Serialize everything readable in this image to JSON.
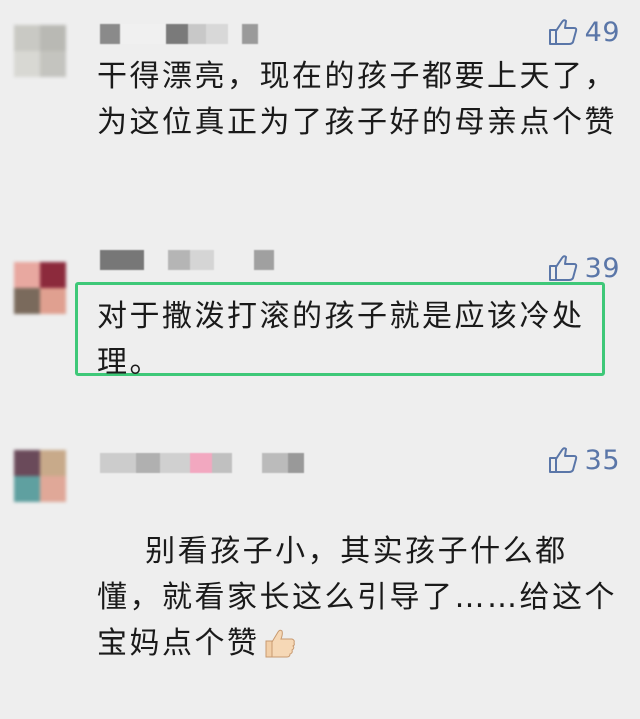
{
  "comments": [
    {
      "likes": "49",
      "text": "干得漂亮，现在的孩子都要上天了，为这位真正为了孩子好的母亲点个赞",
      "avatar_colors": [
        "#c9c9c4",
        "#b9b9b4",
        "#d8d8d3",
        "#c4c4bf"
      ],
      "name_colors": [
        "#8a8a8a",
        "#f0f0f0",
        "#7a7a7a",
        "#c8c8c8",
        "#d8d8d8",
        "#9a9a9a",
        "#aaaaaa"
      ]
    },
    {
      "likes": "39",
      "text": "对于撒泼打滚的孩子就是应该冷处理。",
      "avatar_colors": [
        "#e8a8a0",
        "#8c2a3c",
        "#7a6a5c",
        "#e0a090"
      ],
      "name_colors": [
        "#777777",
        "#eeeeee",
        "#b5b5b5",
        "#d5d5d5",
        "#eeeeee",
        "#a0a0a0"
      ]
    },
    {
      "likes": "35",
      "text": "别看孩子小，其实孩子什么都懂，就看家长这么引导了……给这个宝妈点个赞",
      "avatar_colors": [
        "#6a4a5a",
        "#c8aa8a",
        "#5fa0a0",
        "#e0a898"
      ],
      "name_colors": [
        "#cccccc",
        "#b0b0b0",
        "#d0d0d0",
        "#f2a8c0",
        "#c0c0c0",
        "#eeeeee",
        "#bbbbbb",
        "#999999"
      ]
    }
  ],
  "icons": {
    "like": "thumbs-up-icon",
    "emoji": "thumbs-up-emoji"
  },
  "colors": {
    "background": "#eeeeee",
    "highlight_border": "#3ec878",
    "like_color": "#5a76a8"
  }
}
